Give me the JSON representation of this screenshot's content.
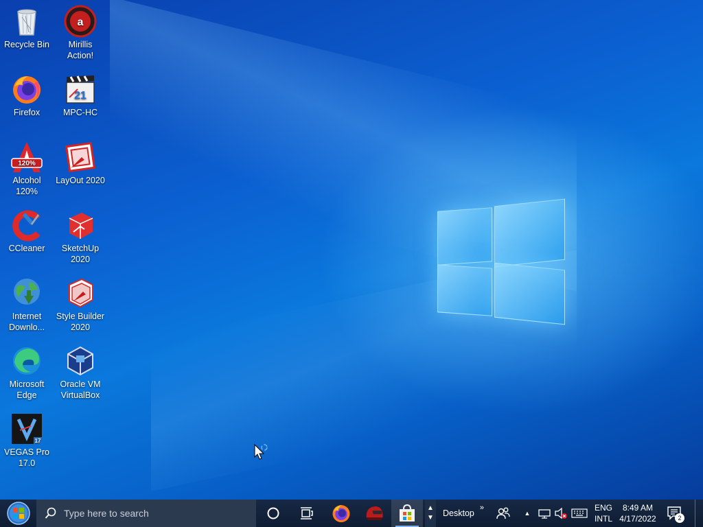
{
  "desktop_icons": [
    {
      "label": "Recycle Bin",
      "icon": "recycle-bin-icon"
    },
    {
      "label": "Mirillis Action!",
      "icon": "mirillis-action-icon"
    },
    {
      "label": "Firefox",
      "icon": "firefox-icon"
    },
    {
      "label": "MPC-HC",
      "icon": "mpc-hc-icon"
    },
    {
      "label": "Alcohol 120%",
      "icon": "alcohol-120-icon"
    },
    {
      "label": "LayOut 2020",
      "icon": "layout-2020-icon"
    },
    {
      "label": "CCleaner",
      "icon": "ccleaner-icon"
    },
    {
      "label": "SketchUp 2020",
      "icon": "sketchup-2020-icon"
    },
    {
      "label": "Internet Downlo...",
      "icon": "internet-download-manager-icon"
    },
    {
      "label": "Style Builder 2020",
      "icon": "style-builder-2020-icon"
    },
    {
      "label": "Microsoft Edge",
      "icon": "microsoft-edge-icon"
    },
    {
      "label": "Oracle VM VirtualBox",
      "icon": "virtualbox-icon"
    },
    {
      "label": "VEGAS Pro 17.0",
      "icon": "vegas-pro-icon"
    }
  ],
  "taskbar": {
    "search_placeholder": "Type here to search",
    "toolbar_label": "Desktop",
    "language_top": "ENG",
    "language_bottom": "INTL",
    "time": "8:49 AM",
    "date": "4/17/2022",
    "notification_count": "2",
    "vegas_badge": "17",
    "mpc_badge": "21"
  },
  "colors": {
    "taskbar_bg": "#10203a",
    "search_bg": "#2b3a4f",
    "accent": "#0078d7"
  }
}
